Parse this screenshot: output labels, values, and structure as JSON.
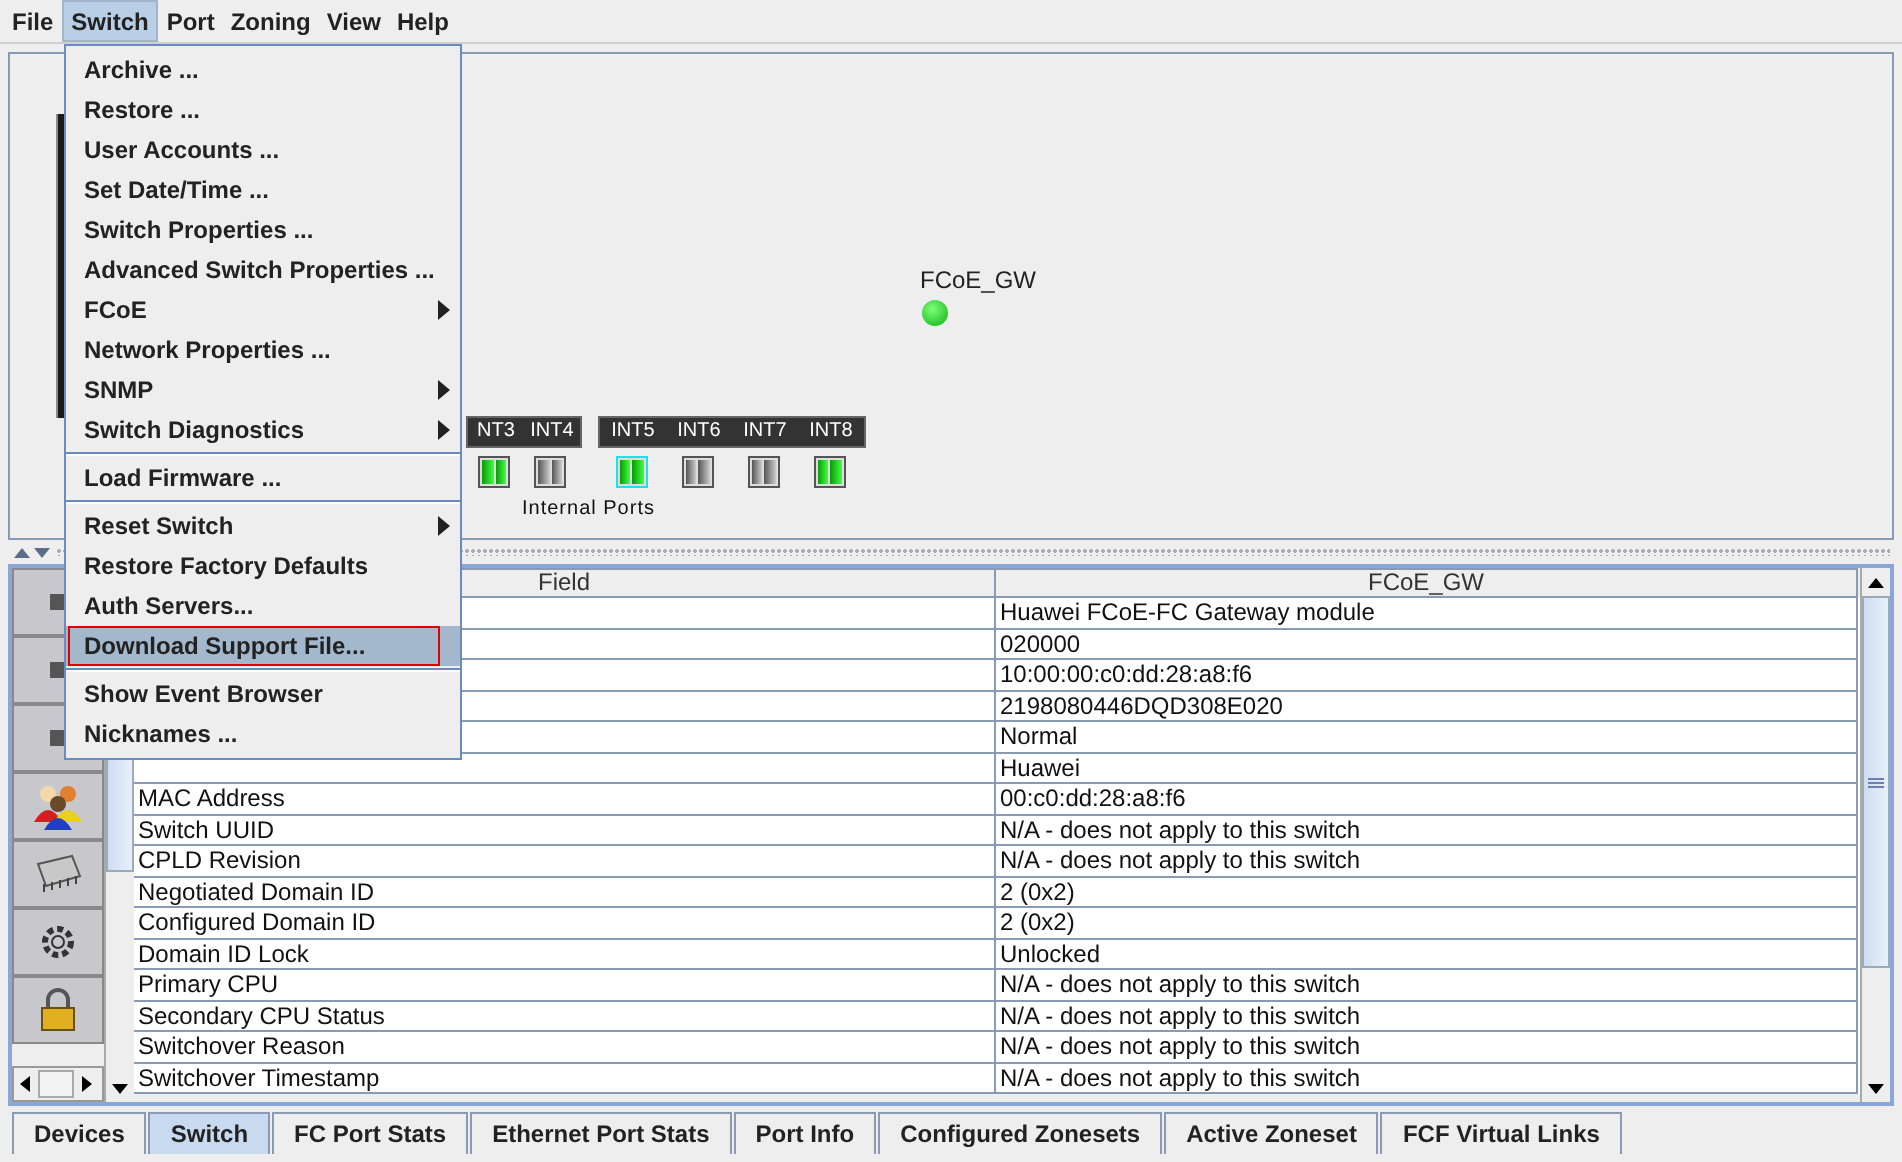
{
  "menu_bar": [
    {
      "label": "File",
      "selected": false
    },
    {
      "label": "Switch",
      "selected": true
    },
    {
      "label": "Port",
      "selected": false
    },
    {
      "label": "Zoning",
      "selected": false
    },
    {
      "label": "View",
      "selected": false
    },
    {
      "label": "Help",
      "selected": false
    }
  ],
  "switch_menu": {
    "items": [
      {
        "kind": "item",
        "label": "Archive ...",
        "submenu": false,
        "selected": false
      },
      {
        "kind": "item",
        "label": "Restore ...",
        "submenu": false,
        "selected": false
      },
      {
        "kind": "item",
        "label": "User Accounts ...",
        "submenu": false,
        "selected": false
      },
      {
        "kind": "item",
        "label": "Set Date/Time ...",
        "submenu": false,
        "selected": false
      },
      {
        "kind": "item",
        "label": "Switch Properties ...",
        "submenu": false,
        "selected": false
      },
      {
        "kind": "item",
        "label": "Advanced Switch Properties ...",
        "submenu": false,
        "selected": false
      },
      {
        "kind": "item",
        "label": "FCoE",
        "submenu": true,
        "selected": false
      },
      {
        "kind": "item",
        "label": "Network Properties ...",
        "submenu": false,
        "selected": false
      },
      {
        "kind": "item",
        "label": "SNMP",
        "submenu": true,
        "selected": false
      },
      {
        "kind": "item",
        "label": "Switch Diagnostics",
        "submenu": true,
        "selected": false
      },
      {
        "kind": "separator"
      },
      {
        "kind": "item",
        "label": "Load Firmware ...",
        "submenu": false,
        "selected": false
      },
      {
        "kind": "separator"
      },
      {
        "kind": "item",
        "label": "Reset Switch",
        "submenu": true,
        "selected": false
      },
      {
        "kind": "item",
        "label": "Restore Factory Defaults",
        "submenu": false,
        "selected": false
      },
      {
        "kind": "item",
        "label": "Auth Servers...",
        "submenu": false,
        "selected": false
      },
      {
        "kind": "item",
        "label": "Download Support File...",
        "submenu": false,
        "selected": true,
        "highlight_box": true
      },
      {
        "kind": "separator"
      },
      {
        "kind": "item",
        "label": "Show Event Browser",
        "submenu": false,
        "selected": false
      },
      {
        "kind": "item",
        "label": "Nicknames ...",
        "submenu": false,
        "selected": false
      }
    ]
  },
  "canvas": {
    "switch_name": "FCoE_GW",
    "online": true,
    "port_groups": [
      {
        "ports": [
          {
            "label": "NT3",
            "online": true,
            "selected": false
          },
          {
            "label": "INT4",
            "online": false,
            "selected": false
          }
        ]
      },
      {
        "ports": [
          {
            "label": "INT5",
            "online": true,
            "selected": true
          },
          {
            "label": "INT6",
            "online": false,
            "selected": false
          },
          {
            "label": "INT7",
            "online": false,
            "selected": false
          },
          {
            "label": "INT8",
            "online": true,
            "selected": false
          }
        ]
      }
    ],
    "ports_caption": "Internal Ports"
  },
  "table": {
    "columns": [
      "Field",
      "FCoE_GW"
    ],
    "rows": [
      {
        "value": "Huawei FCoE-FC Gateway module"
      },
      {
        "value": "020000"
      },
      {
        "value": "10:00:00:c0:dd:28:a8:f6"
      },
      {
        "value": "2198080446DQD308E020"
      },
      {
        "value": "Normal"
      },
      {
        "value": "Huawei"
      },
      {
        "field": "MAC Address",
        "value": "00:c0:dd:28:a8:f6"
      },
      {
        "field": "Switch UUID",
        "value": "N/A - does not apply to this switch"
      },
      {
        "field": "CPLD Revision",
        "value": "N/A - does not apply to this switch"
      },
      {
        "field": "Negotiated Domain ID",
        "value": "2 (0x2)"
      },
      {
        "field": "Configured Domain ID",
        "value": "2 (0x2)"
      },
      {
        "field": "Domain ID Lock",
        "value": "Unlocked"
      },
      {
        "field": "Primary CPU",
        "value": "N/A - does not apply to this switch"
      },
      {
        "field": "Secondary CPU Status",
        "value": "N/A - does not apply to this switch"
      },
      {
        "field": "Switchover Reason",
        "value": "N/A - does not apply to this switch"
      },
      {
        "field": "Switchover Timestamp",
        "value": "N/A - does not apply to this switch"
      }
    ]
  },
  "tabs": [
    {
      "label": "Devices",
      "selected": false
    },
    {
      "label": "Switch",
      "selected": true
    },
    {
      "label": "FC Port Stats",
      "selected": false
    },
    {
      "label": "Ethernet Port Stats",
      "selected": false
    },
    {
      "label": "Port Info",
      "selected": false
    },
    {
      "label": "Configured Zonesets",
      "selected": false
    },
    {
      "label": "Active Zoneset",
      "selected": false
    },
    {
      "label": "FCF Virtual Links",
      "selected": false
    }
  ]
}
